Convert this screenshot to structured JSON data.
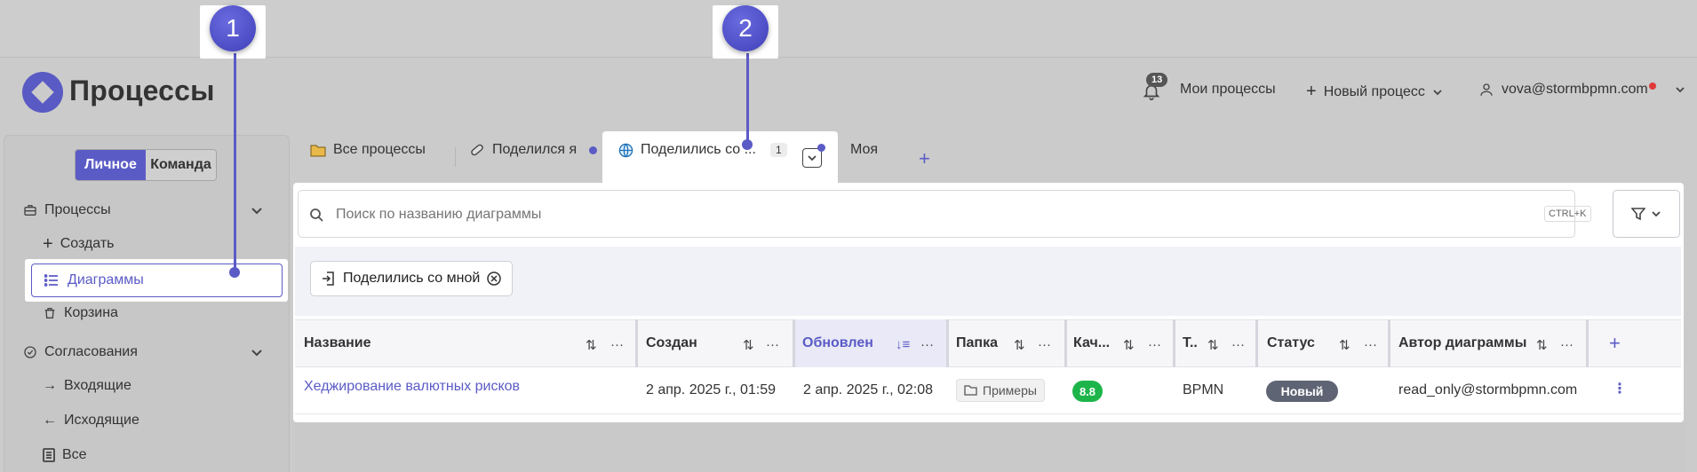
{
  "header": {
    "app_title": "Процессы",
    "notifications_count": "13",
    "my_processes": "Мои процессы",
    "new_process": "Новый процесс",
    "user_email": "vova@stormbpmn.com"
  },
  "sidebar": {
    "segment_personal": "Личное",
    "segment_team": "Команда",
    "groups": [
      {
        "label": "Процессы",
        "items": [
          "Создать",
          "Диаграммы",
          "Корзина"
        ]
      },
      {
        "label": "Согласования",
        "items": [
          "Входящие",
          "Исходящие",
          "Все"
        ]
      }
    ]
  },
  "tabs": [
    {
      "label": "Все процессы"
    },
    {
      "label": "Поделился я"
    },
    {
      "label": "Поделились со ...",
      "count": "1"
    },
    {
      "label": "Моя"
    }
  ],
  "search": {
    "placeholder": "Поиск по названию диаграммы",
    "shortcut": "CTRL+K"
  },
  "filter_chip": "Поделились со мной",
  "table": {
    "columns": [
      "Название",
      "Создан",
      "Обновлен",
      "Папка",
      "Кач...",
      "Т..",
      "Статус",
      "Автор диаграммы"
    ],
    "rows": [
      {
        "name": "Хеджирование валютных рисков",
        "created": "2 апр. 2025 г., 01:59",
        "updated": "2 апр. 2025 г., 02:08",
        "folder": "Примеры",
        "quality": "8.8",
        "type": "BPMN",
        "status": "Новый",
        "author": "read_only@stormbpmn.com"
      }
    ]
  },
  "callouts": [
    "1",
    "2"
  ],
  "colors": {
    "accent": "#5b5bc6",
    "quality": "#1db54a",
    "status": "#5e6473"
  }
}
